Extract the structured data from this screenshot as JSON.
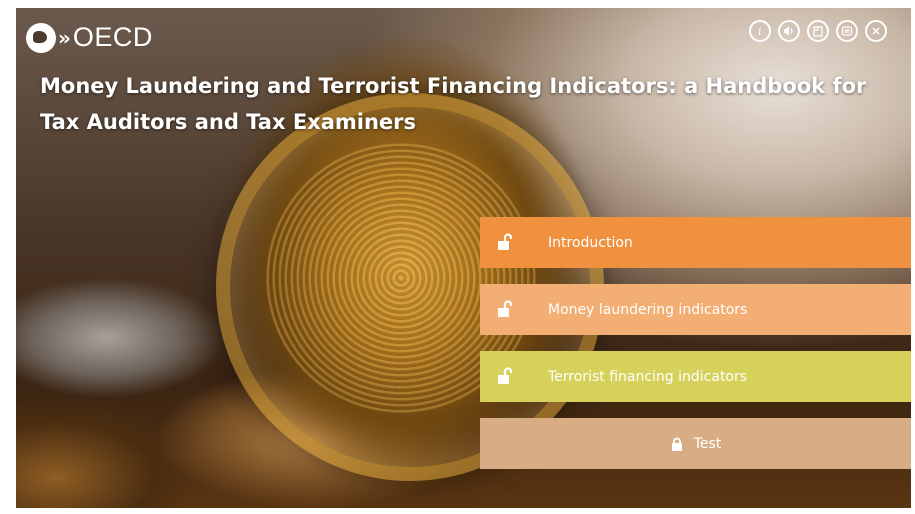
{
  "header": {
    "logo_text": "OECD",
    "logo_chevrons": "»",
    "toolbar": [
      {
        "name": "info-icon",
        "label": "i"
      },
      {
        "name": "audio-icon",
        "label": ""
      },
      {
        "name": "pages-icon",
        "label": ""
      },
      {
        "name": "menu-icon",
        "label": ""
      },
      {
        "name": "close-icon",
        "label": ""
      }
    ]
  },
  "title": "Money Laundering and Terrorist Financing Indicators: a Handbook for Tax Auditors and Tax Examiners",
  "menu": {
    "items": [
      {
        "label": "Introduction",
        "status": "unlocked",
        "color": "#f0913f"
      },
      {
        "label": "Money laundering indicators",
        "status": "unlocked",
        "color": "#f2ae73"
      },
      {
        "label": "Terrorist financing indicators",
        "status": "unlocked",
        "color": "#d6d15a"
      },
      {
        "label": "Test",
        "status": "locked",
        "color": "#d8ad86"
      }
    ]
  },
  "colors": {
    "accent_orange": "#f0913f",
    "accent_light_orange": "#f2ae73",
    "accent_yellow": "#d6d15a",
    "accent_tan": "#d8ad86"
  }
}
